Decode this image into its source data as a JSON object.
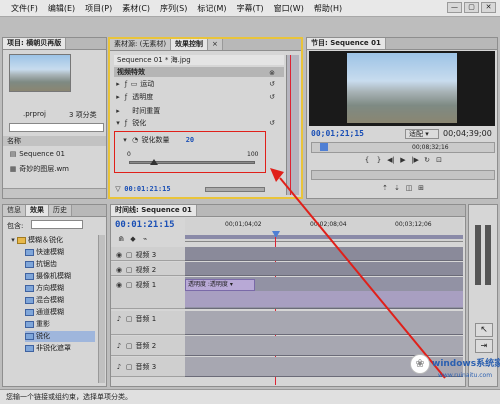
{
  "menu": [
    "文件(F)",
    "编辑(E)",
    "项目(P)",
    "素材(C)",
    "序列(S)",
    "标记(M)",
    "字幕(T)",
    "窗口(W)",
    "帮助(H)"
  ],
  "window_buttons": [
    "—",
    "▢",
    "✕"
  ],
  "project_panel": {
    "tab": "项目: 横朝贝再版",
    "file_text": ".prproj",
    "count_text": "3 项分类",
    "column_name": "名称",
    "items": [
      "Sequence 01",
      "奇妙的图层.wm"
    ]
  },
  "effect_controls": {
    "tabs": [
      "素材源: (无素材)",
      "效果控制",
      "×"
    ],
    "sequence_label": "Sequence 01 * 海.jpg",
    "section_video": "视频特效",
    "fx_rows": [
      "运动",
      "透明度",
      "时间重置",
      "锐化"
    ],
    "param_name": "锐化数量",
    "param_value": "20",
    "slider_min": "0",
    "slider_max": "100",
    "slider_value_fraction": 0.2,
    "bottom_timecode": "00:01:21:15"
  },
  "program_monitor": {
    "tab": "节目: Sequence 01",
    "timecode_left": "00;01;21;15",
    "fit_label": "适配",
    "timecode_right": "00;04;39;00",
    "ruler_mid": "00;08;32;16"
  },
  "effects_panel": {
    "tabs": [
      "信息",
      "效果",
      "历史"
    ],
    "search_label": "包含:",
    "tree": [
      "模糊＆锐化",
      "快速模糊",
      "抗锯齿",
      "摄像机模糊",
      "方向模糊",
      "混合模糊",
      "通道模糊",
      "重影",
      "锐化",
      "非锐化遮罩"
    ]
  },
  "timeline": {
    "tab": "时间线: Sequence 01",
    "timecode": "00:01:21:15",
    "ruler": [
      "00;01;04;02",
      "00;02;08;04",
      "00;03;12;06"
    ],
    "tracks": [
      "视频 3",
      "视频 2",
      "视频 1",
      "音频 1",
      "音频 2",
      "音频 3"
    ],
    "clip_label": "透明度 :透明度 ▾"
  },
  "status_text": "您输一个链接或组约束，选择单项分类。",
  "watermark": {
    "title": "windows系统家园",
    "url": "www.ruinaitu.com"
  },
  "colors": {
    "timecode_blue": "#1a4fb5",
    "highlight_red": "#e0201a",
    "panel_yellow": "#e9c43a",
    "clip_purple": "#b8a9d6"
  }
}
